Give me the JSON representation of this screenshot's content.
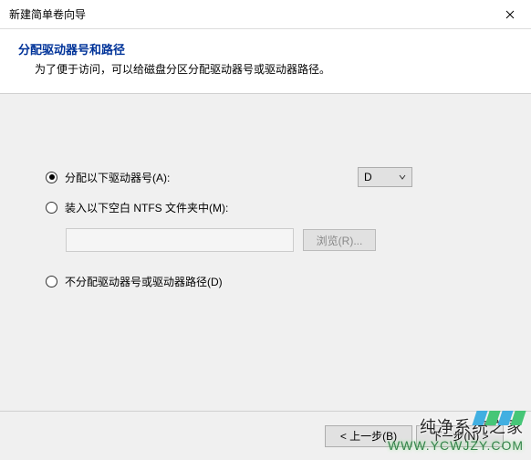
{
  "window": {
    "title": "新建简单卷向导"
  },
  "header": {
    "title": "分配驱动器号和路径",
    "subtitle": "为了便于访问，可以给磁盘分区分配驱动器号或驱动器路径。"
  },
  "options": {
    "assignLetter": {
      "label": "分配以下驱动器号(A):",
      "value": "D"
    },
    "mountFolder": {
      "label": "装入以下空白 NTFS 文件夹中(M):",
      "path": "",
      "browseLabel": "浏览(R)..."
    },
    "noAssign": {
      "label": "不分配驱动器号或驱动器路径(D)"
    }
  },
  "footer": {
    "back": "< 上一步(B)",
    "next": "下一步(N) >"
  },
  "watermark": {
    "line1": "纯净系统之家",
    "line2": "WWW.YCWJZY.COM"
  }
}
